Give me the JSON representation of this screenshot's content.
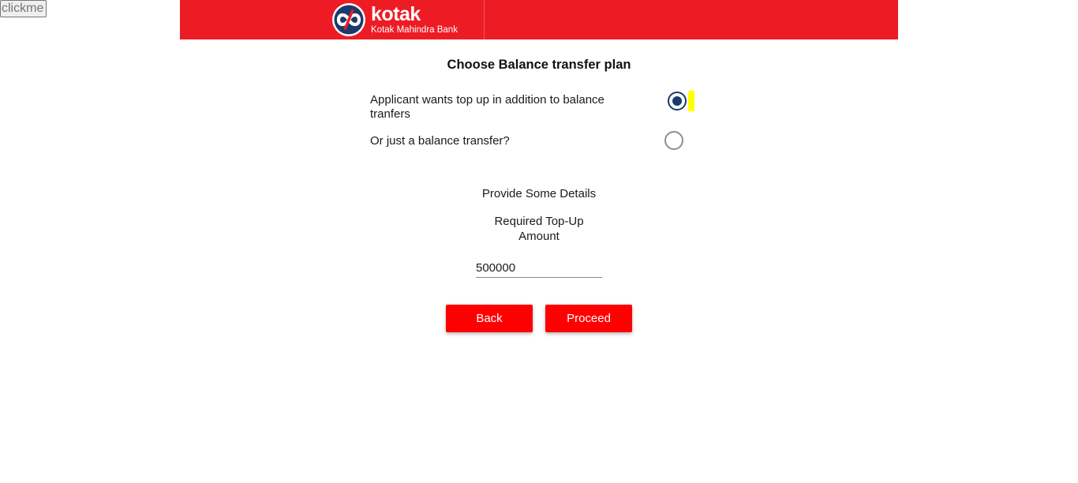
{
  "debug": {
    "clickme_label": "clickme"
  },
  "header": {
    "brand_word": "kotak",
    "brand_subtitle": "Kotak Mahindra Bank",
    "logo_icon": "kotak-infinity-logo",
    "background_color": "#ed1c24"
  },
  "form": {
    "title": "Choose Balance transfer plan",
    "options": [
      {
        "label": "Applicant wants top up in addition to balance tranfers",
        "selected": true
      },
      {
        "label": "Or just a balance transfer?",
        "selected": false
      }
    ],
    "details_heading": "Provide Some Details",
    "amount_label": "Required Top-Up Amount",
    "amount_value": "500000",
    "back_label": "Back",
    "proceed_label": "Proceed",
    "button_color": "#ff0000",
    "radio_selected_color": "#1b3a6b"
  }
}
